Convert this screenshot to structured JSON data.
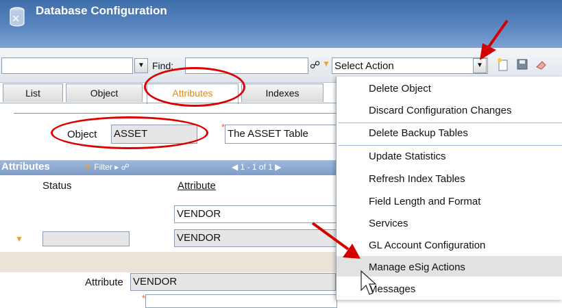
{
  "header": {
    "title": "Database Configuration",
    "icon": "database-config-icon"
  },
  "toolbar": {
    "find_label": "Find:",
    "find_value": "",
    "select_action_label": "Select Action",
    "icons": [
      "binoculars-icon",
      "filter-icon",
      "new-record-icon",
      "save-icon",
      "clear-icon"
    ]
  },
  "tabs": [
    {
      "label": "List",
      "active": false
    },
    {
      "label": "Object",
      "active": false
    },
    {
      "label": "Attributes",
      "active": true
    },
    {
      "label": "Indexes",
      "active": false
    }
  ],
  "object_section": {
    "object_label": "Object",
    "object_value": "ASSET",
    "description_value": "The ASSET Table"
  },
  "attributes_table": {
    "title": "Attributes",
    "filter_label": "Filter",
    "pager_text": "1 - 1 of 1",
    "headers": {
      "status": "Status",
      "attribute": "Attribute"
    },
    "rows": [
      {
        "status": "",
        "attribute": "VENDOR"
      },
      {
        "status": "",
        "attribute": "VENDOR"
      }
    ]
  },
  "details": {
    "attribute_label": "Attribute",
    "attribute_value": "VENDOR"
  },
  "action_menu": {
    "items": [
      "Delete Object",
      "Discard Configuration Changes",
      "Delete Backup Tables",
      "Update Statistics",
      "Refresh Index Tables",
      "Field Length and Format",
      "Services",
      "GL Account Configuration",
      "Manage eSig Actions",
      "Messages"
    ],
    "hovered": "Manage eSig Actions"
  },
  "colors": {
    "header": "#4a78b4",
    "annotation_red": "#dd0000",
    "active_tab_text": "#e08a1a"
  }
}
